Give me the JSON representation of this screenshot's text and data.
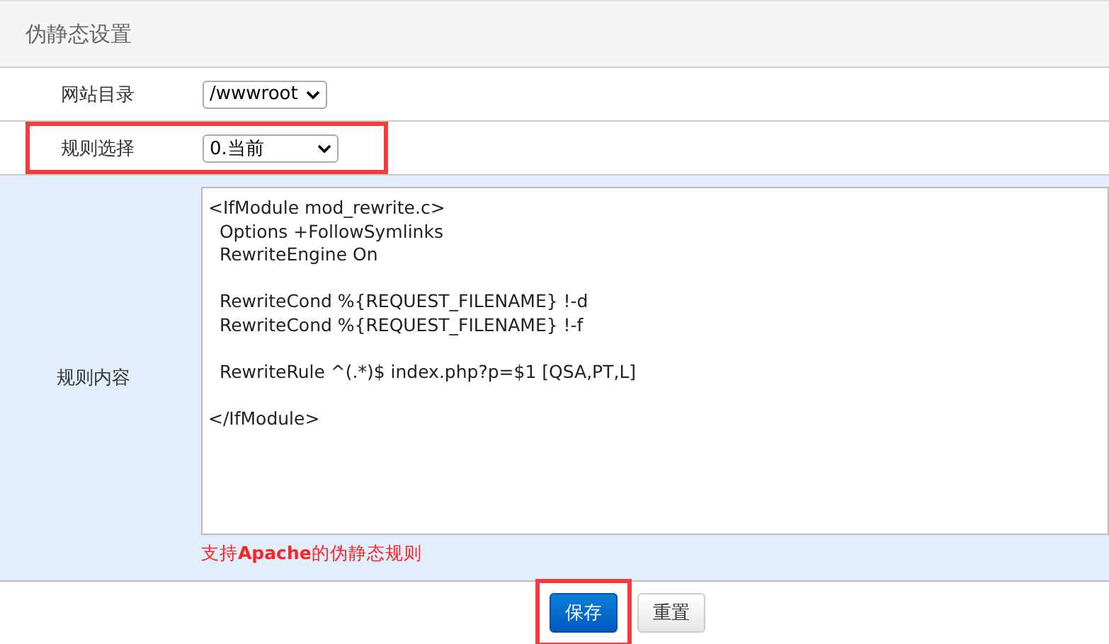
{
  "title": "伪静态设置",
  "fields": [
    {
      "label": "网站目录",
      "value": "/wwwroot",
      "highlighted": false
    },
    {
      "label": "规则选择",
      "value": "0.当前",
      "highlighted": true
    }
  ],
  "rule": {
    "label": "规则内容",
    "code": "<IfModule mod_rewrite.c>\n  Options +FollowSymlinks\n  RewriteEngine On\n\n  RewriteCond %{REQUEST_FILENAME} !-d\n  RewriteCond %{REQUEST_FILENAME} !-f\n\n  RewriteRule ^(.*)$ index.php?p=$1 [QSA,PT,L]\n\n</IfModule>",
    "note": "支持**Apache**的伪静态规则"
  },
  "buttons": [
    {
      "label": "保存",
      "kind": "primary",
      "highlighted": true
    },
    {
      "label": "重置",
      "kind": "default",
      "highlighted": false
    }
  ]
}
